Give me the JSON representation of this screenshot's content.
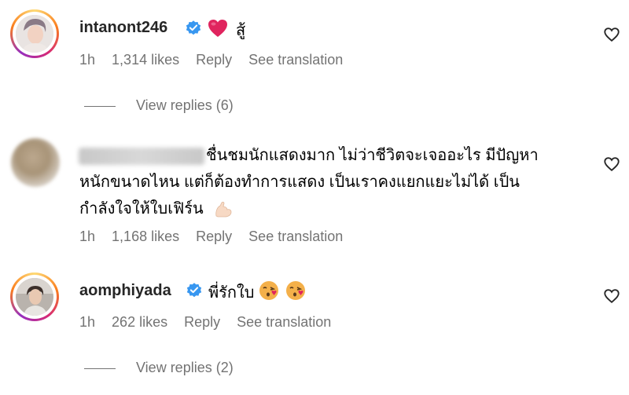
{
  "comments": [
    {
      "username": "intanont246",
      "verified": true,
      "text": "สู้",
      "time": "1h",
      "likes": "1,314 likes",
      "reply": "Reply",
      "translate": "See translation",
      "view_replies": "View replies (6)"
    },
    {
      "username": "",
      "verified": false,
      "line1": "ชื่นชมนักแสดงมาก ไม่ว่าชีวิตจะเจออะไร มีปัญหา",
      "line2": "หนักขนาดไหน แต่ก็ต้องทำการแสดง เป็นเราคงแยกแยะไม่ได้ เป็น",
      "line3": "กำลังใจให้ใบเฟิร์น",
      "time": "1h",
      "likes": "1,168 likes",
      "reply": "Reply",
      "translate": "See translation"
    },
    {
      "username": "aomphiyada",
      "verified": true,
      "text": "พี่รักใบ",
      "time": "1h",
      "likes": "262 likes",
      "reply": "Reply",
      "translate": "See translation",
      "view_replies": "View replies (2)"
    }
  ],
  "colors": {
    "verified": "#3897f0",
    "muted": "#737373",
    "heart_emoji": "#e0245e"
  },
  "icons": [
    "heart-outline-icon",
    "verified-badge-icon",
    "heart-emoji-icon",
    "flexed-biceps-emoji-icon",
    "face-blowing-kiss-emoji-icon"
  ]
}
